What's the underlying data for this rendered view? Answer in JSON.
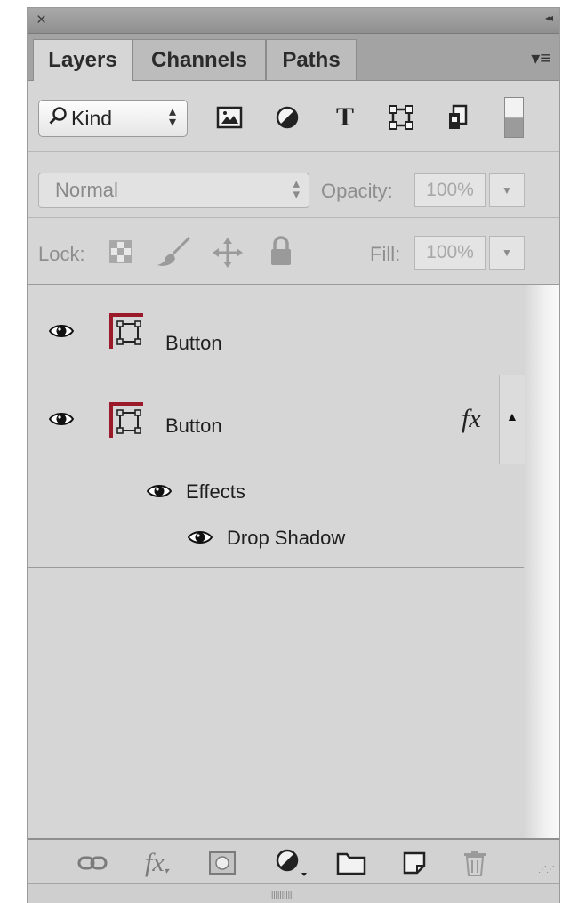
{
  "titlebar": {
    "close_glyph": "×",
    "collapse_glyph": "◂◂"
  },
  "tabs": [
    {
      "label": "Layers",
      "active": true
    },
    {
      "label": "Channels",
      "active": false
    },
    {
      "label": "Paths",
      "active": false
    }
  ],
  "panel_menu_glyph": "▾≡",
  "filter": {
    "kind_label": "Kind",
    "icons": [
      "pixel-layer-filter-icon",
      "adjustment-layer-filter-icon",
      "type-layer-filter-icon",
      "shape-layer-filter-icon",
      "smart-object-filter-icon"
    ],
    "type_glyph": "T"
  },
  "blend": {
    "mode": "Normal",
    "opacity_label": "Opacity:",
    "opacity_value": "100%"
  },
  "lock": {
    "label": "Lock:",
    "fill_label": "Fill:",
    "fill_value": "100%"
  },
  "layers": [
    {
      "name": "Button",
      "visible": true,
      "has_fx": false
    },
    {
      "name": "Button",
      "visible": true,
      "has_fx": true,
      "fx_label": "fx",
      "effects_label": "Effects",
      "effects": [
        {
          "name": "Drop Shadow"
        }
      ]
    }
  ],
  "colors": {
    "panel_bg": "#d6d6d6",
    "shape_icon_red": "#9b1a2a"
  }
}
